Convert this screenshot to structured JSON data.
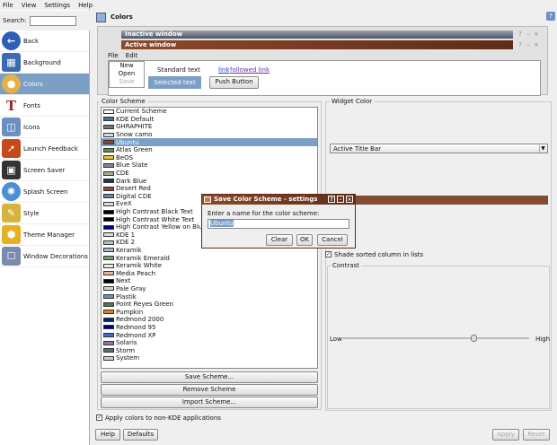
{
  "menubar": {
    "items": [
      "File",
      "View",
      "Settings",
      "Help"
    ]
  },
  "search": {
    "label": "Search:",
    "value": ""
  },
  "sidebar": {
    "items": [
      {
        "label": "Back",
        "icon": "back-arrow-icon",
        "color": "#2d5fb8"
      },
      {
        "label": "Background",
        "icon": "background-icon",
        "color": "#3a6ab0"
      },
      {
        "label": "Colors",
        "icon": "palette-icon",
        "color": "#e7b14a",
        "selected": true
      },
      {
        "label": "Fonts",
        "icon": "fonts-icon",
        "color": "#a12020"
      },
      {
        "label": "Icons",
        "icon": "icons-icon",
        "color": "#6a8fc0"
      },
      {
        "label": "Launch Feedback",
        "icon": "rocket-icon",
        "color": "#c44a1a"
      },
      {
        "label": "Screen Saver",
        "icon": "monitor-icon",
        "color": "#333333"
      },
      {
        "label": "Splash Screen",
        "icon": "splash-icon",
        "color": "#4a8fd0"
      },
      {
        "label": "Style",
        "icon": "style-icon",
        "color": "#d4b43c"
      },
      {
        "label": "Theme Manager",
        "icon": "theme-icon",
        "color": "#e7b020"
      },
      {
        "label": "Window Decorations",
        "icon": "window-icon",
        "color": "#7a8ab0"
      }
    ]
  },
  "header": {
    "title": "Colors"
  },
  "preview": {
    "inactive_title": "Inactive window",
    "active_title": "Active window",
    "menu": [
      "File",
      "Edit"
    ],
    "list": [
      "New",
      "Open",
      "Save"
    ],
    "standard_text": "Standard text",
    "selected_text": "Selected text",
    "link": "link",
    "followed_link": "followed link",
    "push_button": "Push Button"
  },
  "scheme": {
    "legend": "Color Scheme",
    "items": [
      {
        "name": "Current Scheme",
        "swatch": "#ffffff"
      },
      {
        "name": "KDE Default",
        "swatch": "#4a6ea8"
      },
      {
        "name": "GHRAPHITE",
        "swatch": "#777777"
      },
      {
        "name": "Snow camo",
        "swatch": "#dddddd"
      },
      {
        "name": "Ubuntu",
        "swatch": "#8c4a2a",
        "selected": true
      },
      {
        "name": "Atlas Green",
        "swatch": "#6a8a4a"
      },
      {
        "name": "BeOS",
        "swatch": "#e8c830"
      },
      {
        "name": "Blue Slate",
        "swatch": "#7a8aa8"
      },
      {
        "name": "CDE",
        "swatch": "#a8a890"
      },
      {
        "name": "Dark Blue",
        "swatch": "#203060"
      },
      {
        "name": "Desert Red",
        "swatch": "#a04030"
      },
      {
        "name": "Digital CDE",
        "swatch": "#5a8ab0"
      },
      {
        "name": "EveX",
        "swatch": "#dedede"
      },
      {
        "name": "High Contrast Black Text",
        "swatch": "#000000"
      },
      {
        "name": "High Contrast White Text",
        "swatch": "#000000"
      },
      {
        "name": "High Contrast Yellow on Blue",
        "swatch": "#000080"
      },
      {
        "name": "KDE 1",
        "swatch": "#dcdcdc"
      },
      {
        "name": "KDE 2",
        "swatch": "#c0c0c0"
      },
      {
        "name": "Keramik",
        "swatch": "#a0b8d8"
      },
      {
        "name": "Keramik Emerald",
        "swatch": "#70a070"
      },
      {
        "name": "Keramik White",
        "swatch": "#f0f0f0"
      },
      {
        "name": "Media Peach",
        "swatch": "#e8b898"
      },
      {
        "name": "Next",
        "swatch": "#000000"
      },
      {
        "name": "Pale Gray",
        "swatch": "#d0d0d0"
      },
      {
        "name": "Plastik",
        "swatch": "#7090c0"
      },
      {
        "name": "Point Reyes Green",
        "swatch": "#4a7a4a"
      },
      {
        "name": "Pumpkin",
        "swatch": "#e08030"
      },
      {
        "name": "Redmond 2000",
        "swatch": "#0a246a"
      },
      {
        "name": "Redmond 95",
        "swatch": "#000080"
      },
      {
        "name": "Redmond XP",
        "swatch": "#3a6ad8"
      },
      {
        "name": "Solaris",
        "swatch": "#8a7aa8"
      },
      {
        "name": "Storm",
        "swatch": "#5a6a7a"
      },
      {
        "name": "System",
        "swatch": "#d4d0c8"
      }
    ],
    "save_button": "Save Scheme...",
    "remove_button": "Remove Scheme",
    "import_button": "Import Scheme..."
  },
  "widget": {
    "legend": "Widget Color",
    "selected": "Active Title Bar",
    "swatch": "#8c4a2a",
    "shade_label": "Shade sorted column in lists",
    "contrast_legend": "Contrast",
    "low": "Low",
    "high": "High",
    "contrast_value": 0.7
  },
  "apply_label": "Apply colors to non-KDE applications",
  "footer": {
    "help": "Help",
    "defaults": "Defaults",
    "apply": "Apply",
    "reset": "Reset"
  },
  "dialog": {
    "title": "Save Color Scheme - settings",
    "prompt": "Enter a name for the color scheme:",
    "value": "Ubuntu",
    "clear": "Clear",
    "ok": "OK",
    "cancel": "Cancel"
  }
}
